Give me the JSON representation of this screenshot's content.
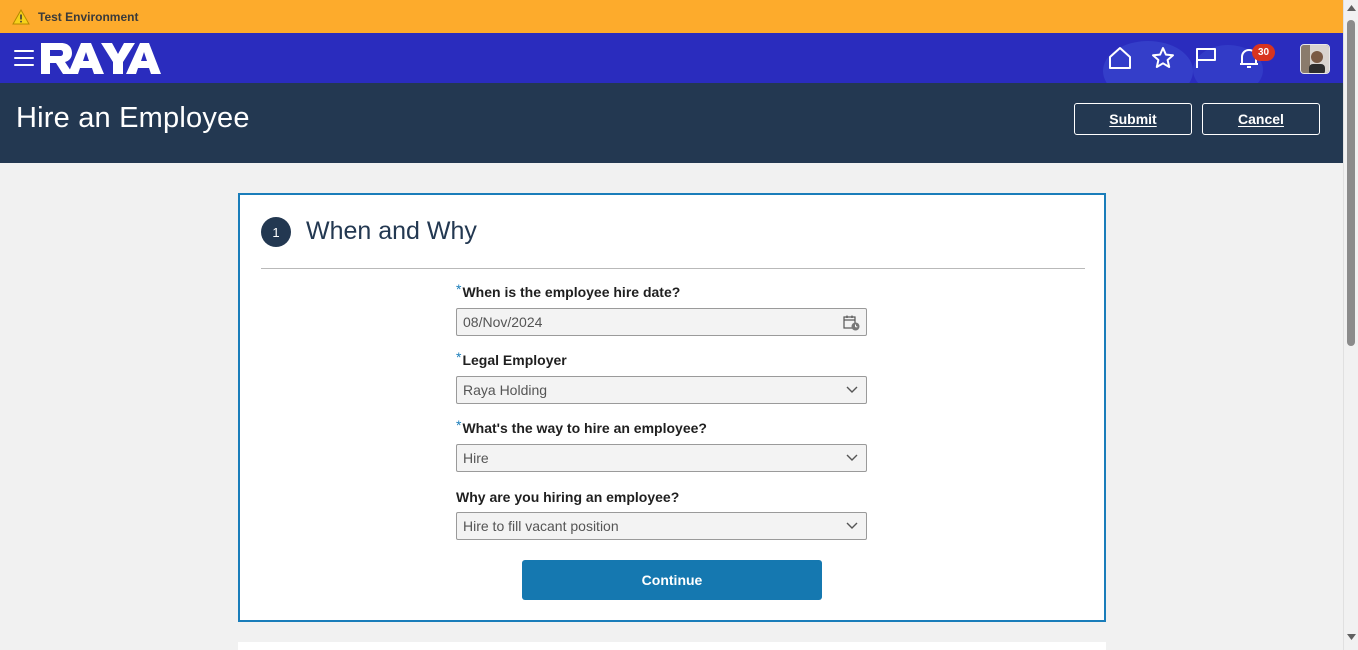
{
  "env_banner": {
    "text": "Test Environment",
    "icon": "warning-icon"
  },
  "brand": {
    "logo_text": "RAYA"
  },
  "nav": {
    "icons": [
      "menu-icon",
      "home-icon",
      "star-icon",
      "flag-icon",
      "bell-icon"
    ],
    "notification_count": "30",
    "accent_color": "#2a2cbe"
  },
  "header": {
    "title": "Hire an Employee",
    "submit_label": "Submit",
    "cancel_label": "Cancel",
    "background_color": "#233851"
  },
  "step": {
    "number": "1",
    "title": "When and Why"
  },
  "form": {
    "hire_date": {
      "label": "When is the employee hire date?",
      "required": true,
      "value": "08/Nov/2024"
    },
    "legal_employer": {
      "label": "Legal Employer",
      "required": true,
      "value": "Raya Holding"
    },
    "hire_way": {
      "label": "What's the way to hire an employee?",
      "required": true,
      "value": "Hire"
    },
    "hire_reason": {
      "label": "Why are you hiring an employee?",
      "required": false,
      "value": "Hire to fill vacant position"
    },
    "required_marker": "*"
  },
  "continue_label": "Continue",
  "primary_button_color": "#1578b0"
}
